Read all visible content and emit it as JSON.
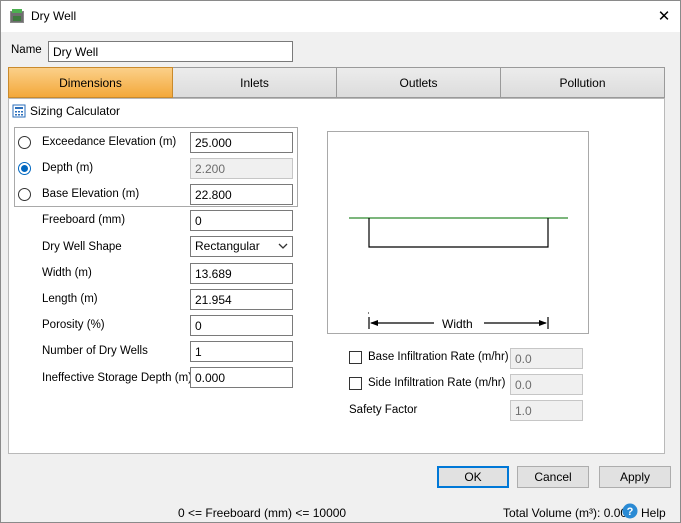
{
  "window": {
    "title": "Dry Well",
    "close_glyph": "✕"
  },
  "name_field": {
    "label": "Name",
    "value": "Dry Well"
  },
  "tabs": [
    {
      "label": "Dimensions",
      "active": true
    },
    {
      "label": "Inlets",
      "active": false
    },
    {
      "label": "Outlets",
      "active": false
    },
    {
      "label": "Pollution",
      "active": false
    }
  ],
  "sizing_calculator": {
    "label": "Sizing Calculator"
  },
  "fields": {
    "exceedance_elevation": {
      "label": "Exceedance Elevation (m)",
      "value": "25.000",
      "selected": false
    },
    "depth": {
      "label": "Depth (m)",
      "value": "2.200",
      "selected": true
    },
    "base_elevation": {
      "label": "Base Elevation (m)",
      "value": "22.800",
      "selected": false
    },
    "freeboard": {
      "label": "Freeboard (mm)",
      "value": "0"
    },
    "shape": {
      "label": "Dry Well Shape",
      "value": "Rectangular"
    },
    "width": {
      "label": "Width (m)",
      "value": "13.689"
    },
    "length": {
      "label": "Length (m)",
      "value": "21.954"
    },
    "porosity": {
      "label": "Porosity (%)",
      "value": "0"
    },
    "number_of_wells": {
      "label": "Number of Dry Wells",
      "value": "1"
    },
    "ineffective_storage": {
      "label": "Ineffective Storage Depth (m)",
      "value": "0.000"
    }
  },
  "preview": {
    "dimension_label": "Width"
  },
  "infiltration": {
    "base": {
      "label": "Base Infiltration Rate (m/hr)",
      "value": "0.0",
      "checked": false
    },
    "side": {
      "label": "Side Infiltration Rate (m/hr)",
      "value": "0.0",
      "checked": false
    },
    "safety_factor": {
      "label": "Safety Factor",
      "value": "1.0"
    }
  },
  "buttons": {
    "ok": "OK",
    "cancel": "Cancel",
    "apply": "Apply"
  },
  "status": {
    "range_hint": "0 <= Freeboard (mm) <= 10000",
    "total_volume": "Total Volume (m³): 0.000",
    "help": "Help"
  },
  "colors": {
    "active_tab": "#f3a83a",
    "water_line": "#2e8b2e",
    "radio_accent": "#0067c0",
    "help_icon": "#2a8ad4"
  }
}
